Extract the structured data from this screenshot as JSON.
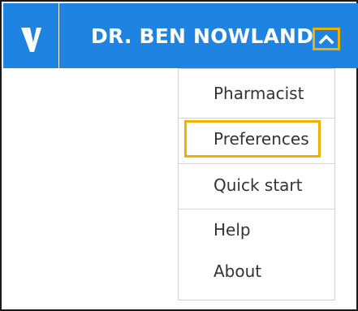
{
  "header": {
    "logo_icon": "v-logo-icon",
    "user_name": "DR. BEN NOWLAND",
    "toggle_icon": "chevron-up-icon",
    "bar_color": "#1f83e1",
    "highlight_color": "#f0b000"
  },
  "menu": {
    "items": [
      {
        "label": "Pharmacist"
      },
      {
        "label": "Preferences",
        "highlighted": true
      },
      {
        "label": "Quick start"
      },
      {
        "label": "Help"
      },
      {
        "label": "About"
      }
    ]
  }
}
